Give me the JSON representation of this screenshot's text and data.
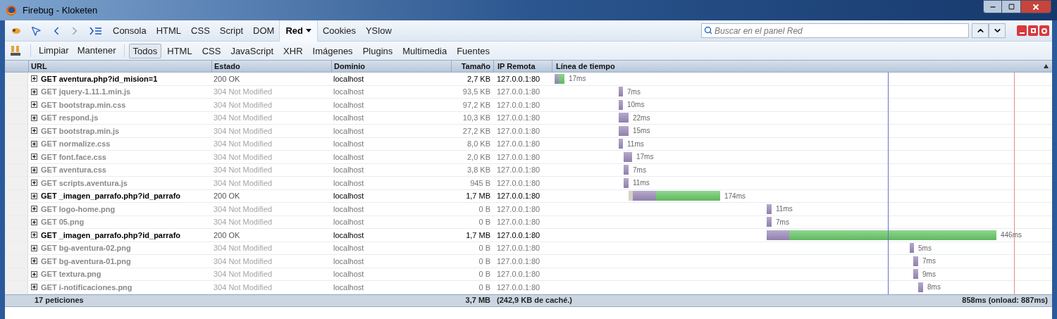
{
  "window": {
    "title": "Firebug - Kloketen"
  },
  "panel_tabs": [
    {
      "label": "Consola",
      "selected": false
    },
    {
      "label": "HTML",
      "selected": false
    },
    {
      "label": "CSS",
      "selected": false
    },
    {
      "label": "Script",
      "selected": false
    },
    {
      "label": "DOM",
      "selected": false
    },
    {
      "label": "Red",
      "selected": true
    },
    {
      "label": "Cookies",
      "selected": false
    },
    {
      "label": "YSlow",
      "selected": false
    }
  ],
  "search": {
    "placeholder": "Buscar en el panel Red"
  },
  "net_toolbar": {
    "actions": [
      "Limpiar",
      "Mantener"
    ],
    "filters": [
      {
        "label": "Todos",
        "selected": true
      },
      {
        "label": "HTML",
        "selected": false
      },
      {
        "label": "CSS",
        "selected": false
      },
      {
        "label": "JavaScript",
        "selected": false
      },
      {
        "label": "XHR",
        "selected": false
      },
      {
        "label": "Imágenes",
        "selected": false
      },
      {
        "label": "Plugins",
        "selected": false
      },
      {
        "label": "Multimedia",
        "selected": false
      },
      {
        "label": "Fuentes",
        "selected": false
      }
    ]
  },
  "table": {
    "columns": [
      "URL",
      "Estado",
      "Dominio",
      "Tamaño",
      "IP Remota",
      "Línea de tiempo"
    ],
    "rows": [
      {
        "url": "GET aventura.php?id_mision=1",
        "status": "200 OK",
        "domain": "localhost",
        "size": "2,7 KB",
        "ip": "127.0.0.1:80",
        "time": "17ms",
        "cached": false
      },
      {
        "url": "GET jquery-1.11.1.min.js",
        "status": "304 Not Modified",
        "domain": "localhost",
        "size": "93,5 KB",
        "ip": "127.0.0.1:80",
        "time": "7ms",
        "cached": true
      },
      {
        "url": "GET bootstrap.min.css",
        "status": "304 Not Modified",
        "domain": "localhost",
        "size": "97,2 KB",
        "ip": "127.0.0.1:80",
        "time": "10ms",
        "cached": true
      },
      {
        "url": "GET respond.js",
        "status": "304 Not Modified",
        "domain": "localhost",
        "size": "10,3 KB",
        "ip": "127.0.0.1:80",
        "time": "22ms",
        "cached": true
      },
      {
        "url": "GET bootstrap.min.js",
        "status": "304 Not Modified",
        "domain": "localhost",
        "size": "27,2 KB",
        "ip": "127.0.0.1:80",
        "time": "15ms",
        "cached": true
      },
      {
        "url": "GET normalize.css",
        "status": "304 Not Modified",
        "domain": "localhost",
        "size": "8,0 KB",
        "ip": "127.0.0.1:80",
        "time": "11ms",
        "cached": true
      },
      {
        "url": "GET font.face.css",
        "status": "304 Not Modified",
        "domain": "localhost",
        "size": "2,0 KB",
        "ip": "127.0.0.1:80",
        "time": "17ms",
        "cached": true
      },
      {
        "url": "GET aventura.css",
        "status": "304 Not Modified",
        "domain": "localhost",
        "size": "3,8 KB",
        "ip": "127.0.0.1:80",
        "time": "7ms",
        "cached": true
      },
      {
        "url": "GET scripts.aventura.js",
        "status": "304 Not Modified",
        "domain": "localhost",
        "size": "945 B",
        "ip": "127.0.0.1:80",
        "time": "11ms",
        "cached": true
      },
      {
        "url": "GET _imagen_parrafo.php?id_parrafo",
        "status": "200 OK",
        "domain": "localhost",
        "size": "1,7 MB",
        "ip": "127.0.0.1:80",
        "time": "174ms",
        "cached": false
      },
      {
        "url": "GET logo-home.png",
        "status": "304 Not Modified",
        "domain": "localhost",
        "size": "0 B",
        "ip": "127.0.0.1:80",
        "time": "11ms",
        "cached": true
      },
      {
        "url": "GET 05.png",
        "status": "304 Not Modified",
        "domain": "localhost",
        "size": "0 B",
        "ip": "127.0.0.1:80",
        "time": "7ms",
        "cached": true
      },
      {
        "url": "GET _imagen_parrafo.php?id_parrafo",
        "status": "200 OK",
        "domain": "localhost",
        "size": "1,7 MB",
        "ip": "127.0.0.1:80",
        "time": "446ms",
        "cached": false
      },
      {
        "url": "GET bg-aventura-02.png",
        "status": "304 Not Modified",
        "domain": "localhost",
        "size": "0 B",
        "ip": "127.0.0.1:80",
        "time": "5ms",
        "cached": true
      },
      {
        "url": "GET bg-aventura-01.png",
        "status": "304 Not Modified",
        "domain": "localhost",
        "size": "0 B",
        "ip": "127.0.0.1:80",
        "time": "7ms",
        "cached": true
      },
      {
        "url": "GET textura.png",
        "status": "304 Not Modified",
        "domain": "localhost",
        "size": "0 B",
        "ip": "127.0.0.1:80",
        "time": "9ms",
        "cached": true
      },
      {
        "url": "GET i-notificaciones.png",
        "status": "304 Not Modified",
        "domain": "localhost",
        "size": "0 B",
        "ip": "127.0.0.1:80",
        "time": "8ms",
        "cached": true
      }
    ]
  },
  "summary": {
    "requests": "17 peticiones",
    "total_size": "3,7 MB",
    "cache": "(242,9 KB de caché.)",
    "timing": "858ms (onload: 887ms)"
  }
}
